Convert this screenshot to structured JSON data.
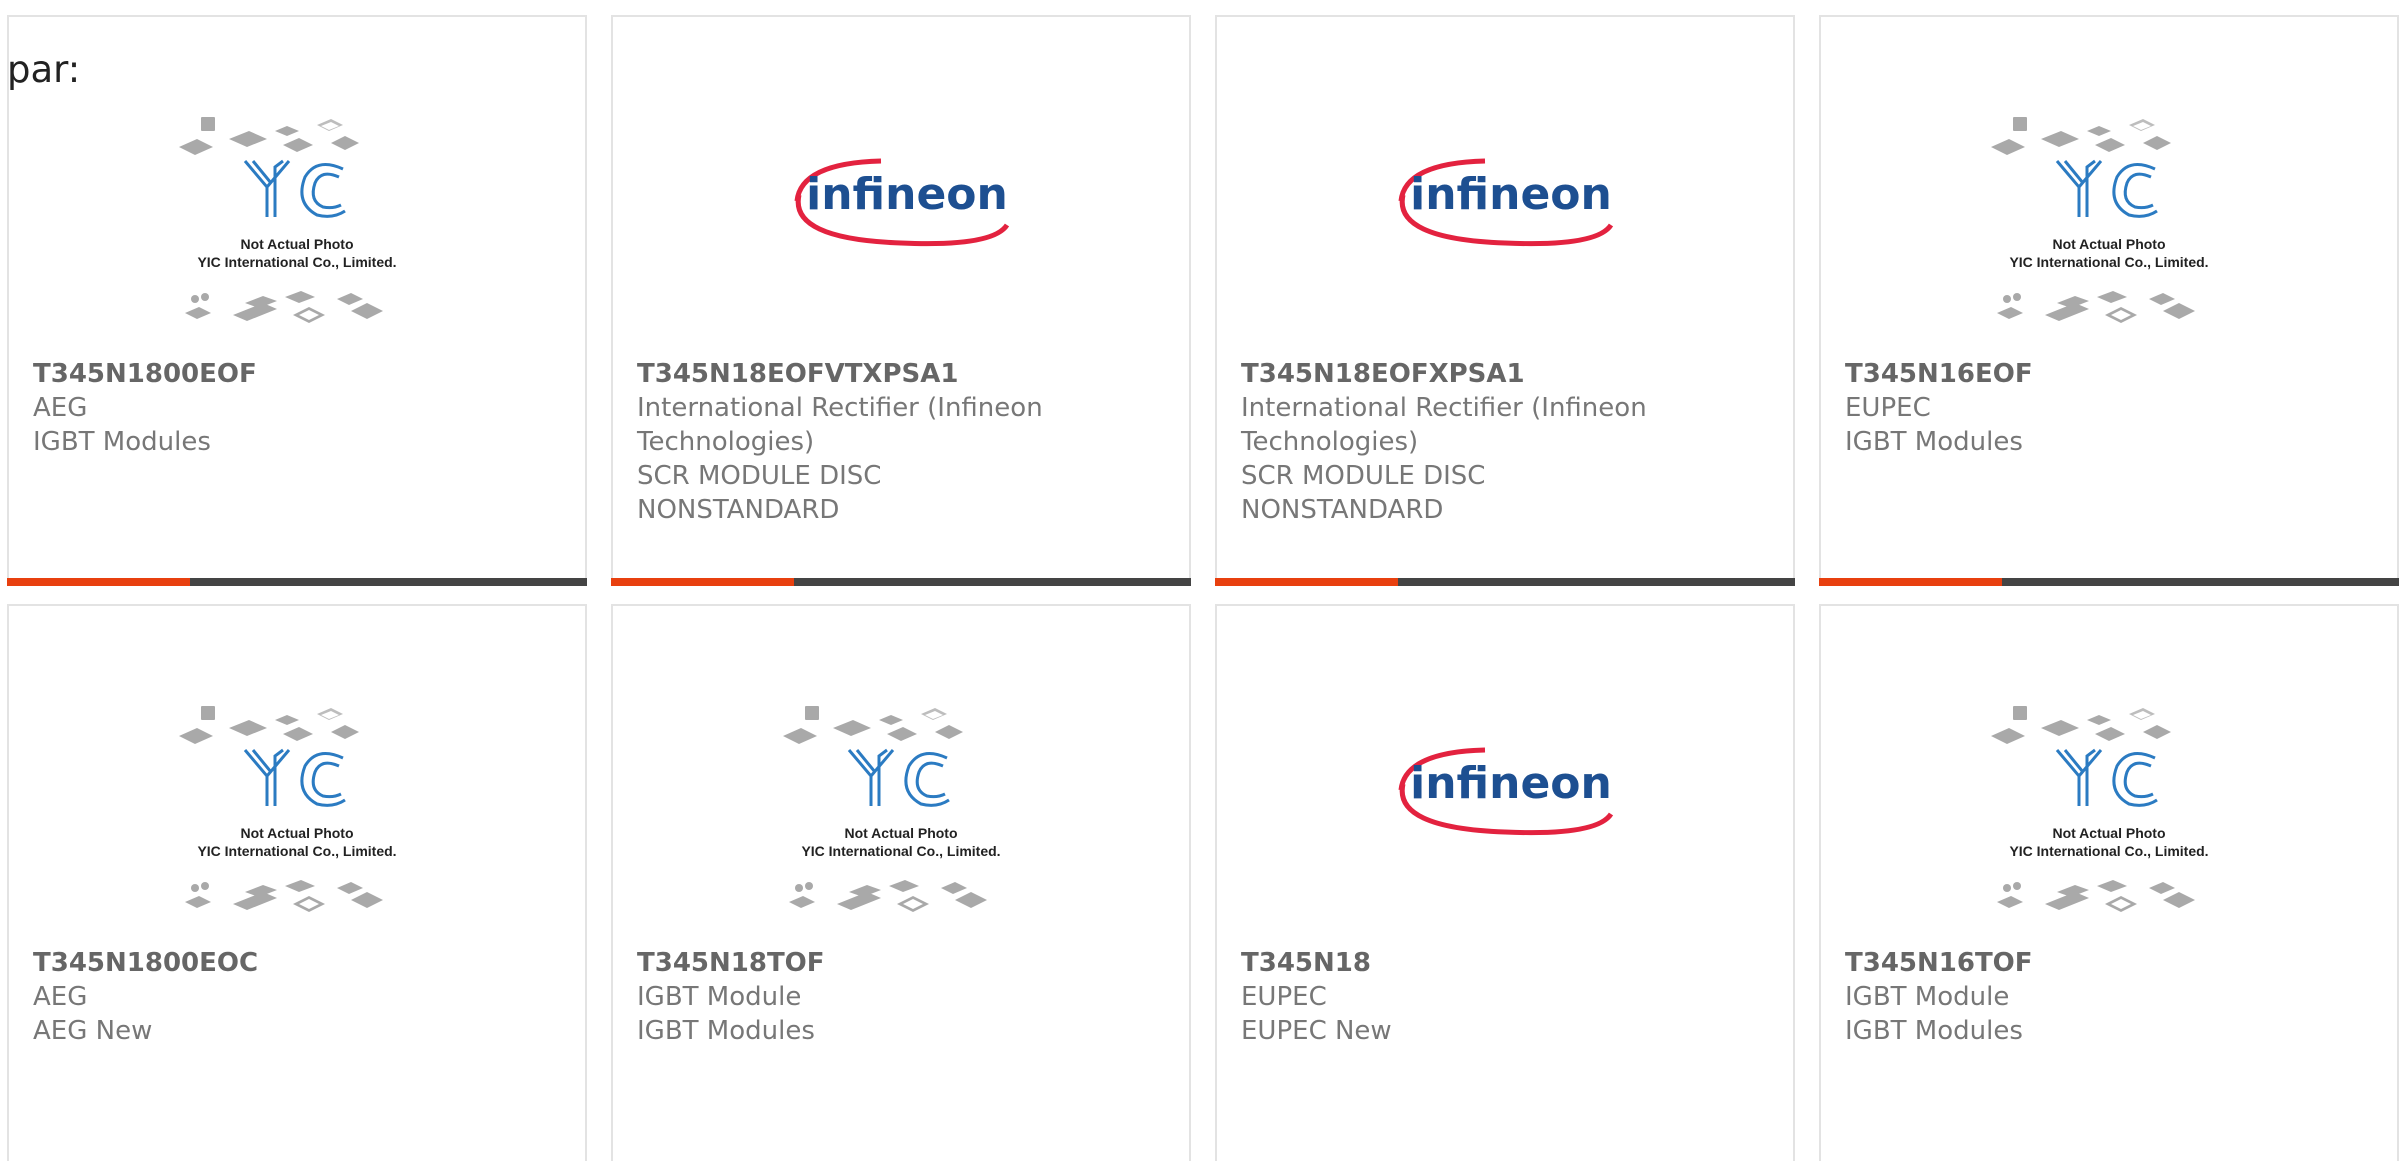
{
  "prefix_text": "par:",
  "placeholder": {
    "line1": "Not Actual Photo",
    "line2": "YIC International Co., Limited.",
    "logo_text": "YIC"
  },
  "brand_logo": {
    "text": "infineon",
    "text_color": "#1d4f91",
    "swoosh_color": "#e3223f"
  },
  "accent_color": "#e8400f",
  "bar_color": "#444444",
  "cards": [
    {
      "image": "yic-placeholder",
      "part": "T345N1800EOF",
      "lines": [
        "AEG",
        "IGBT Modules"
      ]
    },
    {
      "image": "infineon-logo",
      "part": "T345N18EOFVTXPSA1",
      "lines": [
        "International Rectifier (Infineon",
        "Technologies)",
        "SCR MODULE DISC",
        "NONSTANDARD"
      ]
    },
    {
      "image": "infineon-logo",
      "part": "T345N18EOFXPSA1",
      "lines": [
        "International Rectifier (Infineon",
        "Technologies)",
        "SCR MODULE DISC",
        "NONSTANDARD"
      ]
    },
    {
      "image": "yic-placeholder",
      "part": "T345N16EOF",
      "lines": [
        "EUPEC",
        "IGBT Modules"
      ]
    },
    {
      "image": "yic-placeholder",
      "part": "T345N1800EOC",
      "lines": [
        "AEG",
        "AEG New"
      ]
    },
    {
      "image": "yic-placeholder",
      "part": "T345N18TOF",
      "lines": [
        "IGBT Module",
        "IGBT Modules"
      ]
    },
    {
      "image": "infineon-logo",
      "part": "T345N18",
      "lines": [
        "EUPEC",
        "EUPEC New"
      ]
    },
    {
      "image": "yic-placeholder",
      "part": "T345N16TOF",
      "lines": [
        "IGBT Module",
        "IGBT Modules"
      ]
    }
  ]
}
